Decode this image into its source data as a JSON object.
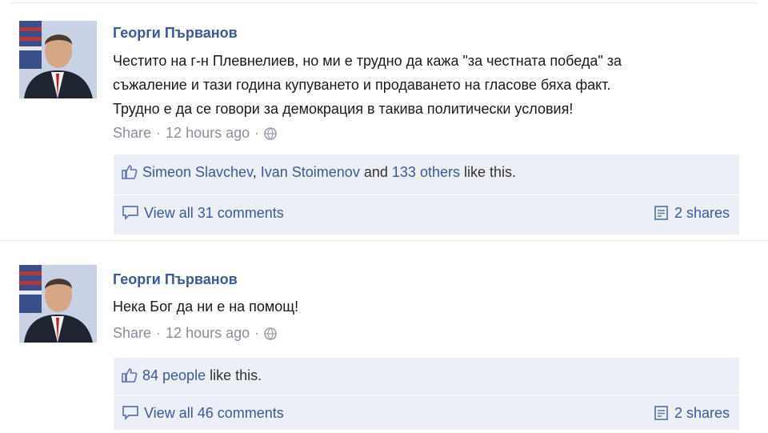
{
  "posts": [
    {
      "author": "Георги Първанов",
      "message_lines": [
        "Честито на г-н Плевнелиев, но ми е трудно да кажа \"за честната победа\" за",
        "съжаление и тази година купуването и продаването на гласове бяха факт.",
        "Трудно е да се говори за демокрация в такива политически условия!"
      ],
      "share_label": "Share",
      "time": "12 hours ago",
      "likes": {
        "name1": "Simeon Slavchev",
        "name2": "Ivan Stoimenov",
        "and_text": "and",
        "others": "133 others",
        "tail": "like this."
      },
      "comments_label": "View all 31 comments",
      "shares_label": "2 shares"
    },
    {
      "author": "Георги Първанов",
      "message_lines": [
        "Нека Бог да ни е на помощ!"
      ],
      "share_label": "Share",
      "time": "12 hours ago",
      "likes": {
        "people": "84 people",
        "tail": "like this."
      },
      "comments_label": "View all 46 comments",
      "shares_label": "2 shares"
    }
  ],
  "colors": {
    "link": "#3b5998",
    "ufi_bg": "#eceff6",
    "meta": "#8a8f9c"
  },
  "icons": [
    "avatar-photo",
    "globe-icon",
    "like-icon",
    "comment-icon",
    "share-icon"
  ]
}
